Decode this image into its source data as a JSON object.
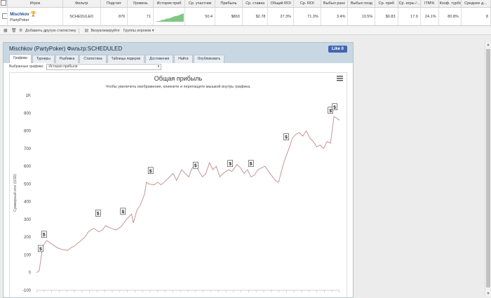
{
  "table": {
    "headers": [
      "Игрок",
      "Фильтр",
      "Подсчет",
      "Уровень",
      "История приб",
      "Ср. участник",
      "Прибыль",
      "Ср. ставка",
      "Общий ROI",
      "Ср. ROI",
      "Выбыл ранс",
      "Выбыл позд",
      "Ср. приб",
      "Ср. игры /…",
      "ITM%",
      "Коэф. турбо",
      "Среднее д…"
    ],
    "row": {
      "player": "Mischkov",
      "room": "PartyPoker",
      "filter": "SCHEDULED",
      "count": "876",
      "level": "71",
      "avg_participants": "50.4",
      "profit": "$863",
      "avg_stake": "$2.78",
      "total_roi": "27.3%",
      "avg_roi": "71.3%",
      "early_out": "3.4%",
      "late_out": "13.5%",
      "avg_profit": "$0.83",
      "avg_games": "17.9",
      "itm": "24.1%",
      "turbo": "80.8%",
      "avg_last": "8"
    }
  },
  "toolbar": {
    "add_stats": "Добавить другую статистику",
    "visualize": "Визуализируйте",
    "player_groups": "Группы игроков ▾"
  },
  "panel": {
    "title": "Mischkov (PartyPoker) Фильтр:SCHEDULED",
    "like": "Like 0",
    "tabs": [
      "Графики",
      "Турниры",
      "Разбивка",
      "Статистика",
      "Таблицы лидеров",
      "Достижения",
      "Найти",
      "Опубликовать"
    ],
    "selected_graph_label": "Выбранные графики:",
    "selected_graph_value": "История прибыли"
  },
  "chart_data": {
    "type": "line",
    "title": "Общая прибыль",
    "subtitle": "Чтобы увеличить изображение, кликните и перетащите мышкой внутрь графика.",
    "ylabel": "Суммарный итог (USD)",
    "xlabel": "",
    "ylim": [
      -100,
      1000
    ],
    "yticks": [
      "-100",
      "0",
      "100",
      "200",
      "300",
      "400",
      "500",
      "600",
      "700",
      "800",
      "900",
      "1K"
    ],
    "grid": false,
    "x": [
      0,
      8,
      18,
      30,
      45,
      60,
      75,
      90,
      100,
      110,
      122,
      140,
      150,
      165,
      180,
      190,
      200,
      215,
      230,
      245,
      260,
      275,
      280,
      290,
      300,
      312,
      318,
      325,
      340,
      350,
      360,
      375,
      385,
      395,
      405,
      420,
      430,
      440,
      450,
      460,
      470,
      480,
      490,
      500,
      510,
      520,
      530,
      540,
      555,
      565,
      580,
      590,
      600,
      610,
      620,
      630,
      640,
      650,
      660,
      675,
      690,
      700,
      712,
      720,
      730,
      740,
      750,
      760,
      770,
      780,
      790,
      800,
      810,
      820,
      830,
      840,
      850,
      860,
      876
    ],
    "values": [
      0,
      10,
      150,
      180,
      160,
      140,
      130,
      125,
      140,
      150,
      170,
      200,
      230,
      250,
      230,
      240,
      265,
      250,
      240,
      260,
      300,
      330,
      280,
      350,
      380,
      440,
      510,
      500,
      495,
      510,
      495,
      520,
      540,
      560,
      520,
      580,
      560,
      540,
      590,
      610,
      570,
      540,
      560,
      620,
      580,
      600,
      540,
      560,
      580,
      570,
      610,
      590,
      560,
      580,
      540,
      550,
      580,
      590,
      600,
      560,
      520,
      510,
      600,
      650,
      700,
      760,
      780,
      790,
      770,
      800,
      760,
      740,
      710,
      720,
      700,
      740,
      730,
      880,
      860
    ],
    "markers": [
      {
        "x": 12,
        "value": 100,
        "label": "$"
      },
      {
        "x": 22,
        "value": 180,
        "label": "$"
      },
      {
        "x": 178,
        "value": 300,
        "label": "$"
      },
      {
        "x": 250,
        "value": 310,
        "label": "$"
      },
      {
        "x": 330,
        "value": 540,
        "label": "$"
      },
      {
        "x": 460,
        "value": 570,
        "label": "$"
      },
      {
        "x": 560,
        "value": 580,
        "label": "$"
      },
      {
        "x": 620,
        "value": 580,
        "label": "$"
      },
      {
        "x": 722,
        "value": 730,
        "label": "$"
      },
      {
        "x": 850,
        "value": 880,
        "label": "$"
      },
      {
        "x": 862,
        "value": 900,
        "label": "$"
      }
    ],
    "line_color": "#c08a8a"
  },
  "spark": [
    0,
    1,
    1,
    2,
    3,
    3,
    4,
    5,
    5,
    6,
    7,
    8,
    9,
    9,
    10,
    11,
    12,
    13
  ]
}
